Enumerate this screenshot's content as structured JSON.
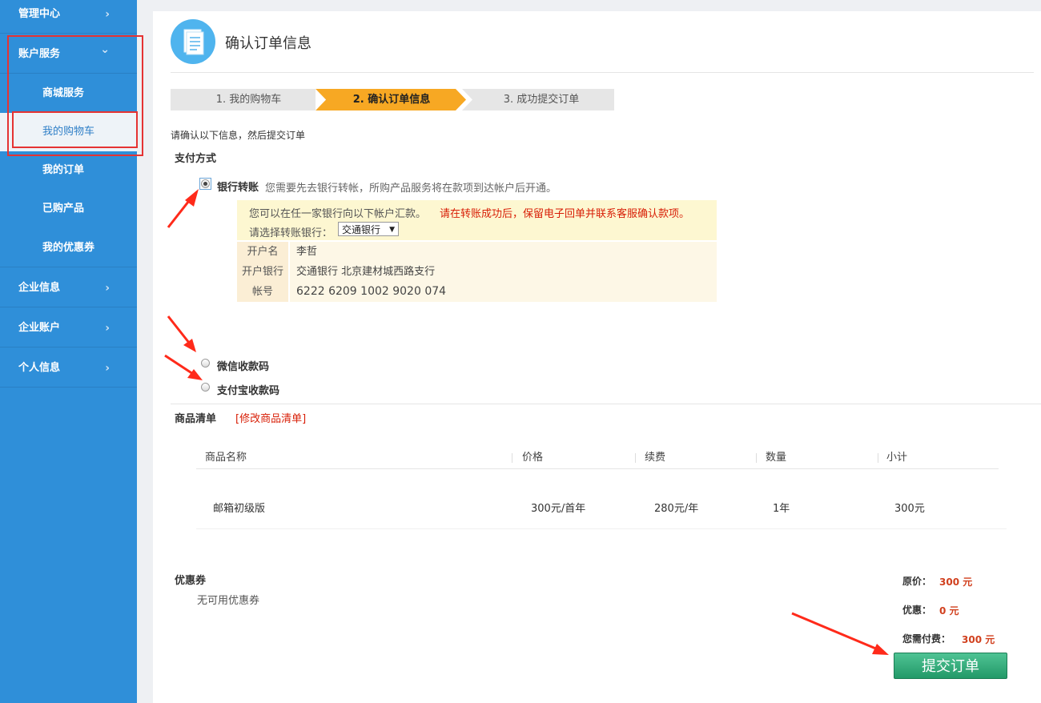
{
  "sidebar": {
    "items": [
      {
        "label": "管理中心"
      },
      {
        "label": "账户服务"
      },
      {
        "label": "商城服务"
      },
      {
        "label": "我的购物车"
      },
      {
        "label": "我的订单"
      },
      {
        "label": "已购产品"
      },
      {
        "label": "我的优惠券"
      },
      {
        "label": "企业信息"
      },
      {
        "label": "企业账户"
      },
      {
        "label": "个人信息"
      }
    ],
    "chevron_right": "›",
    "chevron_down": "⌄"
  },
  "header": {
    "title": "确认订单信息",
    "icon": "document-icon"
  },
  "steps": [
    {
      "label": "1. 我的购物车"
    },
    {
      "label": "2. 确认订单信息"
    },
    {
      "label": "3. 成功提交订单"
    }
  ],
  "intro": "请确认以下信息，然后提交订单",
  "payment": {
    "section_label": "支付方式",
    "bank": {
      "label": "银行转账",
      "desc": "您需要先去银行转帐，所购产品服务将在款项到达帐户后开通。",
      "checked": true,
      "notice_plain": "您可以在任一家银行向以下帐户汇款。",
      "notice_red": "请在转账成功后，保留电子回单并联系客服确认款项。",
      "select_label": "请选择转账银行：",
      "select_value": "交通银行",
      "rows": [
        {
          "key": "开户名",
          "value": "李哲"
        },
        {
          "key": "开户银行",
          "value": "交通银行 北京建材城西路支行"
        },
        {
          "key": "帐号",
          "value": "6222 6209 1002 9020 074"
        }
      ]
    },
    "wechat": {
      "label": "微信收款码",
      "checked": false
    },
    "alipay": {
      "label": "支付宝收款码",
      "checked": false
    }
  },
  "products": {
    "section_label": "商品清单",
    "edit_link": "[修改商品清单]",
    "headers": [
      "商品名称",
      "价格",
      "续费",
      "数量",
      "小计"
    ],
    "rows": [
      {
        "name": "邮箱初级版",
        "price": "300元/首年",
        "renew": "280元/年",
        "qty": "1年",
        "subtotal": "300元"
      }
    ]
  },
  "coupon": {
    "label": "优惠券",
    "value": "无可用优惠券"
  },
  "summary": {
    "original_label": "原价：",
    "original_value": "300 元",
    "discount_label": "优惠：",
    "discount_value": "0 元",
    "payable_label": "您需付费：",
    "payable_value": "300 元"
  },
  "submit_label": "提交订单",
  "colors": {
    "sidebar": "#2f8fd9",
    "step_active": "#f7a823",
    "highlight_box": "#e53333",
    "annotation_arrow": "#ff2a1a",
    "price": "#d1401e",
    "submit": "#229968"
  }
}
